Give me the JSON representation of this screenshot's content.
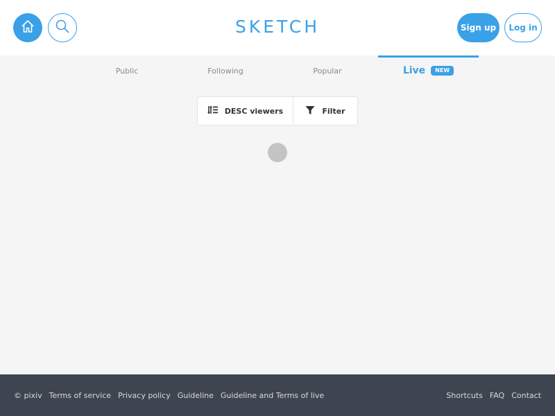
{
  "header": {
    "logo": "SKETCH",
    "signup_label": "Sign up",
    "login_label": "Log in",
    "home_icon": "home-icon",
    "search_icon": "search-icon",
    "accent_color": "#3aa0e8"
  },
  "tabs": [
    {
      "label": "Public"
    },
    {
      "label": "Following"
    },
    {
      "label": "Popular"
    },
    {
      "label": "Live",
      "badge": "NEW",
      "active": true
    }
  ],
  "toolbar": {
    "sort_label": "DESC viewers",
    "sort_icon": "sort-icon",
    "filter_label": "Filter",
    "filter_icon": "filter-icon"
  },
  "footer": {
    "copyright": "© pixiv",
    "left_links": [
      "Terms of service",
      "Privacy policy",
      "Guideline",
      "Guideline and Terms of live"
    ],
    "right_links": [
      "Shortcuts",
      "FAQ",
      "Contact"
    ],
    "background_color": "#3f4550"
  }
}
